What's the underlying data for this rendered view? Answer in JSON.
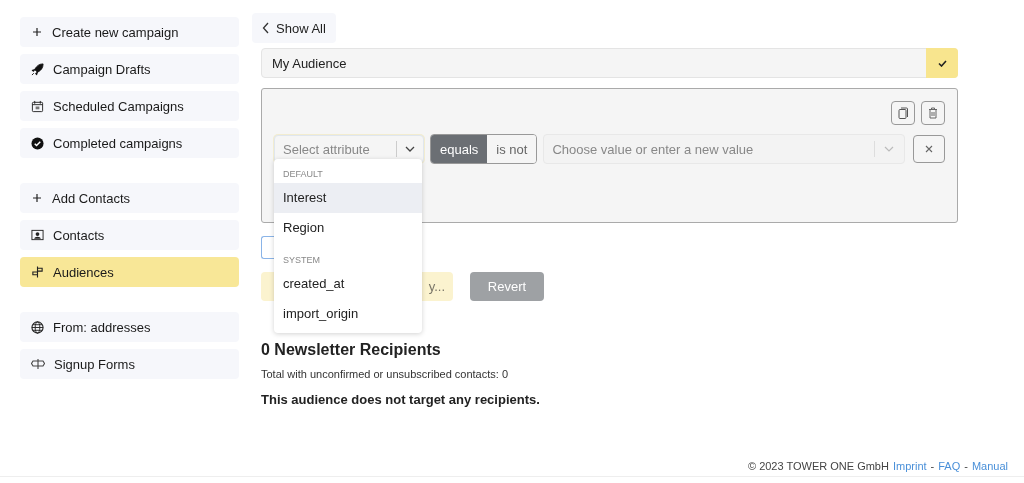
{
  "sidebar": {
    "groups": [
      [
        {
          "label": "Create new campaign",
          "selected": false
        },
        {
          "label": "Campaign Drafts",
          "selected": false
        },
        {
          "label": "Scheduled Campaigns",
          "selected": false
        },
        {
          "label": "Completed campaigns",
          "selected": false
        }
      ],
      [
        {
          "label": "Add Contacts",
          "selected": false
        },
        {
          "label": "Contacts",
          "selected": false
        },
        {
          "label": "Audiences",
          "selected": true
        }
      ],
      [
        {
          "label": "From: addresses",
          "selected": false
        },
        {
          "label": "Signup Forms",
          "selected": false
        }
      ]
    ]
  },
  "back_button": {
    "label": "Show All"
  },
  "audience_name": {
    "value": "My Audience"
  },
  "rule": {
    "attribute": {
      "placeholder": "Select attribute"
    },
    "operators": [
      {
        "label": "equals",
        "selected": true
      },
      {
        "label": "is not",
        "selected": false
      }
    ],
    "value": {
      "placeholder": "Choose value or enter a new value"
    }
  },
  "attribute_menu": {
    "groups": [
      {
        "heading": "DEFAULT",
        "items": [
          {
            "label": "Interest",
            "selected": true
          },
          {
            "label": "Region",
            "selected": false
          }
        ]
      },
      {
        "heading": "SYSTEM",
        "items": [
          {
            "label": "created_at",
            "selected": false
          },
          {
            "label": "import_origin",
            "selected": false
          }
        ]
      }
    ]
  },
  "actions": {
    "save_label": "y...",
    "revert_label": "Revert"
  },
  "summary": {
    "heading": "0 Newsletter Recipients",
    "total": "Total with unconfirmed or unsubscribed contacts: 0",
    "note": "This audience does not target any recipients."
  },
  "footer": {
    "copyright": "© 2023 TOWER ONE GmbH",
    "separator": "-",
    "links": [
      "Imprint",
      "FAQ",
      "Manual"
    ]
  }
}
